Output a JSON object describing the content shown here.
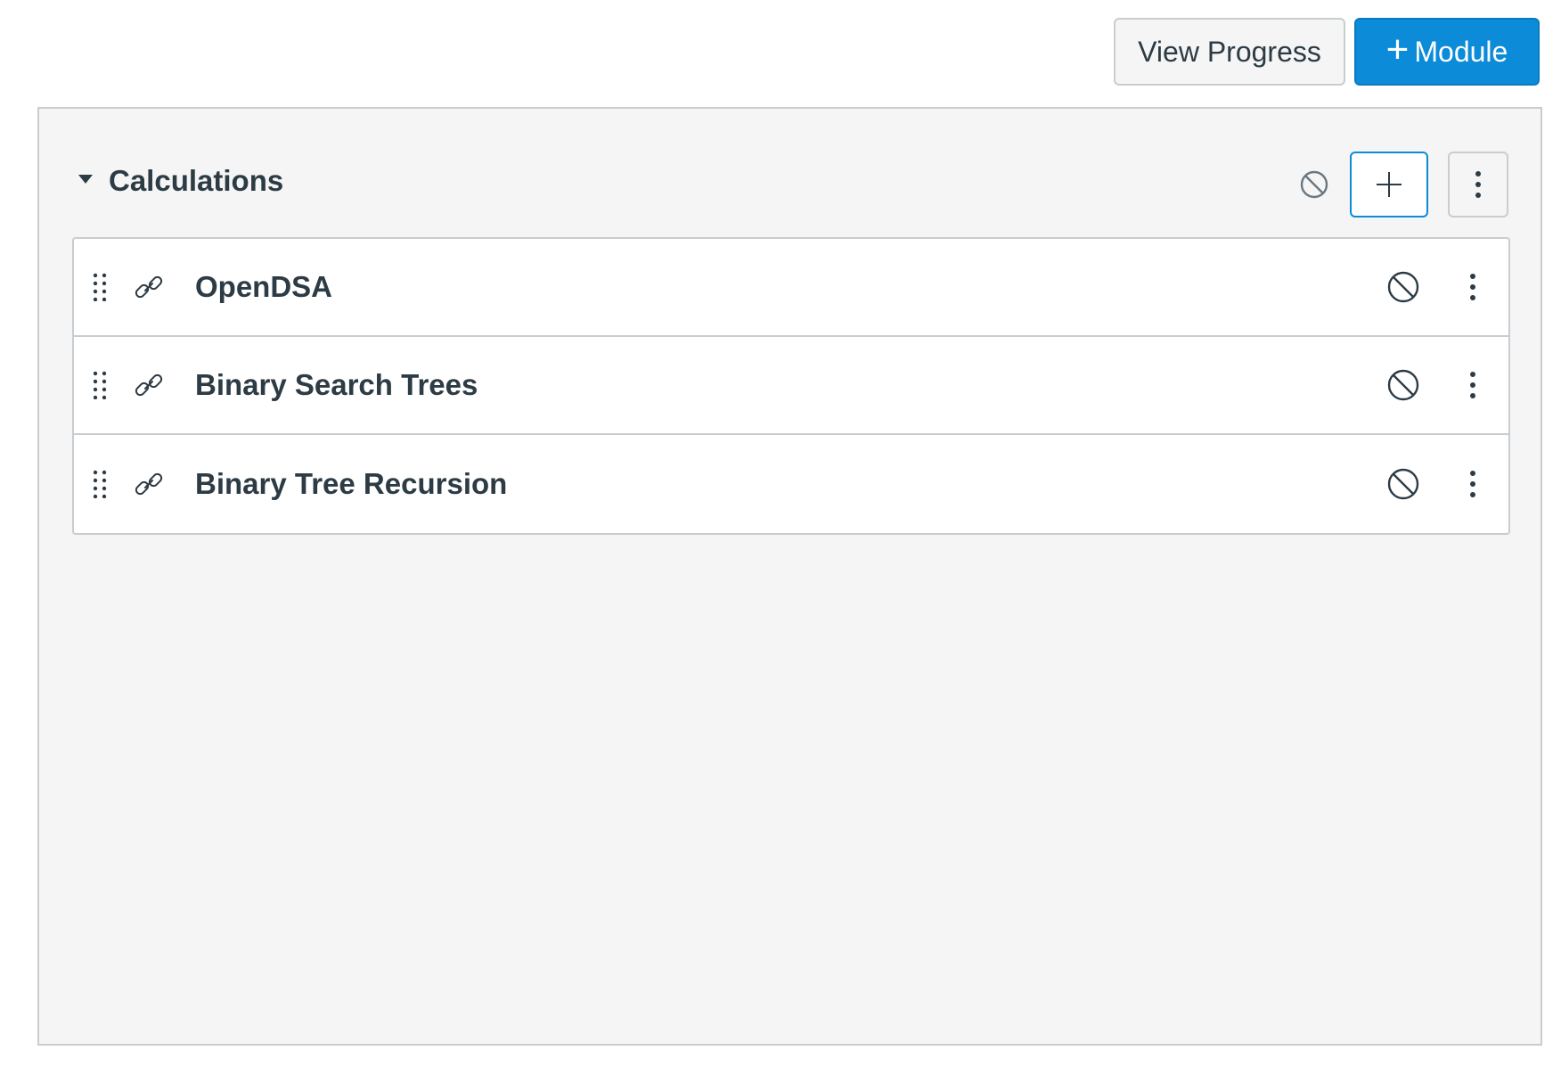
{
  "toolbar": {
    "view_progress_label": "View Progress",
    "add_module_plus": "+",
    "add_module_label": "Module"
  },
  "module": {
    "title": "Calculations",
    "collapsed": false,
    "published": false,
    "items": [
      {
        "title": "OpenDSA",
        "type": "link-icon",
        "published": false
      },
      {
        "title": "Binary Search Trees",
        "type": "link-icon",
        "published": false
      },
      {
        "title": "Binary Tree Recursion",
        "type": "link-icon",
        "published": false
      }
    ]
  },
  "colors": {
    "primary": "#0b8bd8",
    "text": "#2d3b45",
    "border": "#c7cdd1",
    "module_bg": "#f5f5f5",
    "icon_gray": "#6b7780"
  }
}
